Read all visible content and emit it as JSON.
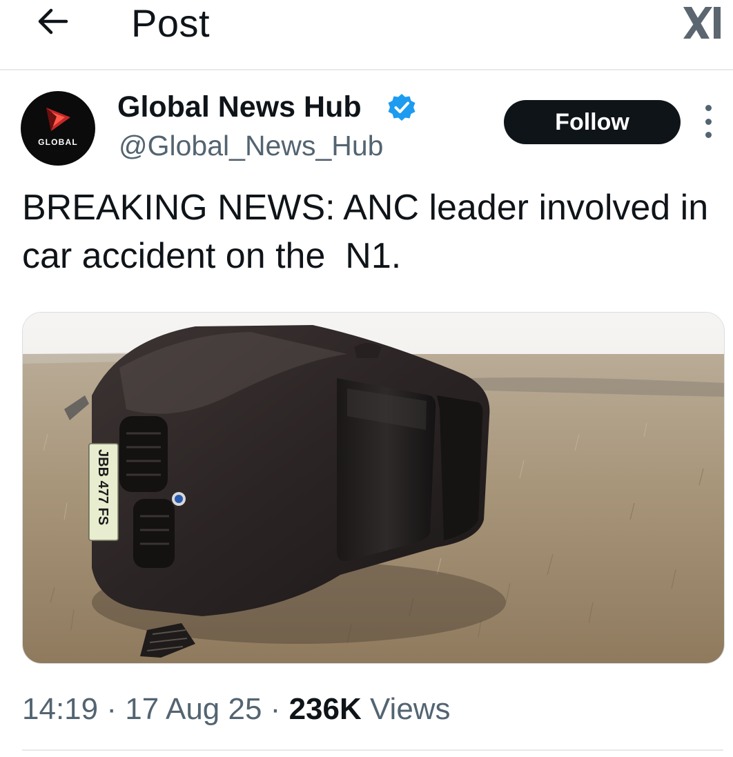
{
  "header": {
    "back_icon": "arrow-left-icon",
    "title": "Post",
    "logo_icon": "x-logo-icon"
  },
  "author": {
    "avatar_text": "GLOBAL",
    "display_name": "Global News Hub",
    "verified_icon": "verified-badge-icon",
    "handle": "@Global_News_Hub",
    "follow_label": "Follow",
    "more_icon": "more-vertical-icon"
  },
  "post": {
    "text": "BREAKING NEWS: ANC leader involved in car accident on the  N1.",
    "image": {
      "plate_text": "JBB 477 FS"
    }
  },
  "meta": {
    "time": "14:19",
    "date": "17 Aug 25",
    "separator": "·",
    "views_count": "236K",
    "views_label": "Views"
  },
  "colors": {
    "text_primary": "#0f1419",
    "text_secondary": "#536471",
    "verified_blue": "#1d9bf0",
    "divider": "#e6e8ea"
  }
}
